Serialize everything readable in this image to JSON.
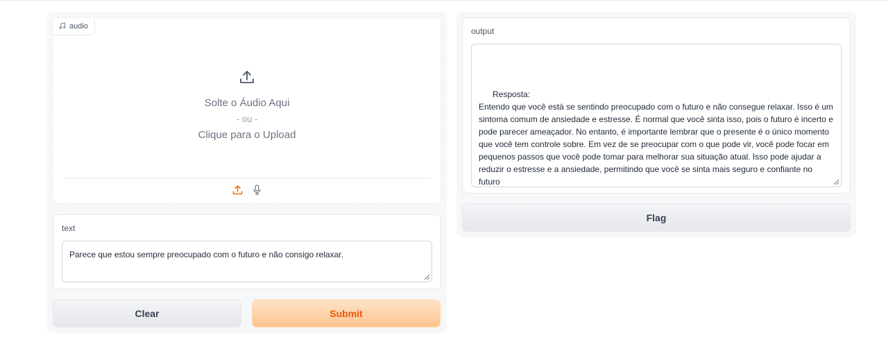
{
  "audio": {
    "label": "audio",
    "drop_text": "Solte o Áudio Aqui",
    "or_text": "- ou -",
    "click_text": "Clique para o Upload",
    "accent_color": "#f97316"
  },
  "text_input": {
    "label": "text",
    "value": "Parece que estou sempre preocupado com o futuro e não consigo relaxar."
  },
  "buttons": {
    "clear": "Clear",
    "submit": "Submit",
    "flag": "Flag"
  },
  "output": {
    "label": "output",
    "value": "Resposta:\nEntendo que você está se sentindo preocupado com o futuro e não consegue relaxar. Isso é um sintoma comum de ansiedade e estresse. É normal que você sinta isso, pois o futuro é incerto e pode parecer ameaçador. No entanto, é importante lembrar que o presente é o único momento que você tem controle sobre. Em vez de se preocupar com o que pode vir, você pode focar em pequenos passos que você pode tomar para melhorar sua situação atual. Isso pode ajudar a reduzir o estresse e a ansiedade, permitindo que você se sinta mais seguro e confiante no futuro"
  },
  "icons": {
    "badge": "music-note-icon",
    "upload": "upload-icon",
    "mic": "microphone-icon"
  }
}
